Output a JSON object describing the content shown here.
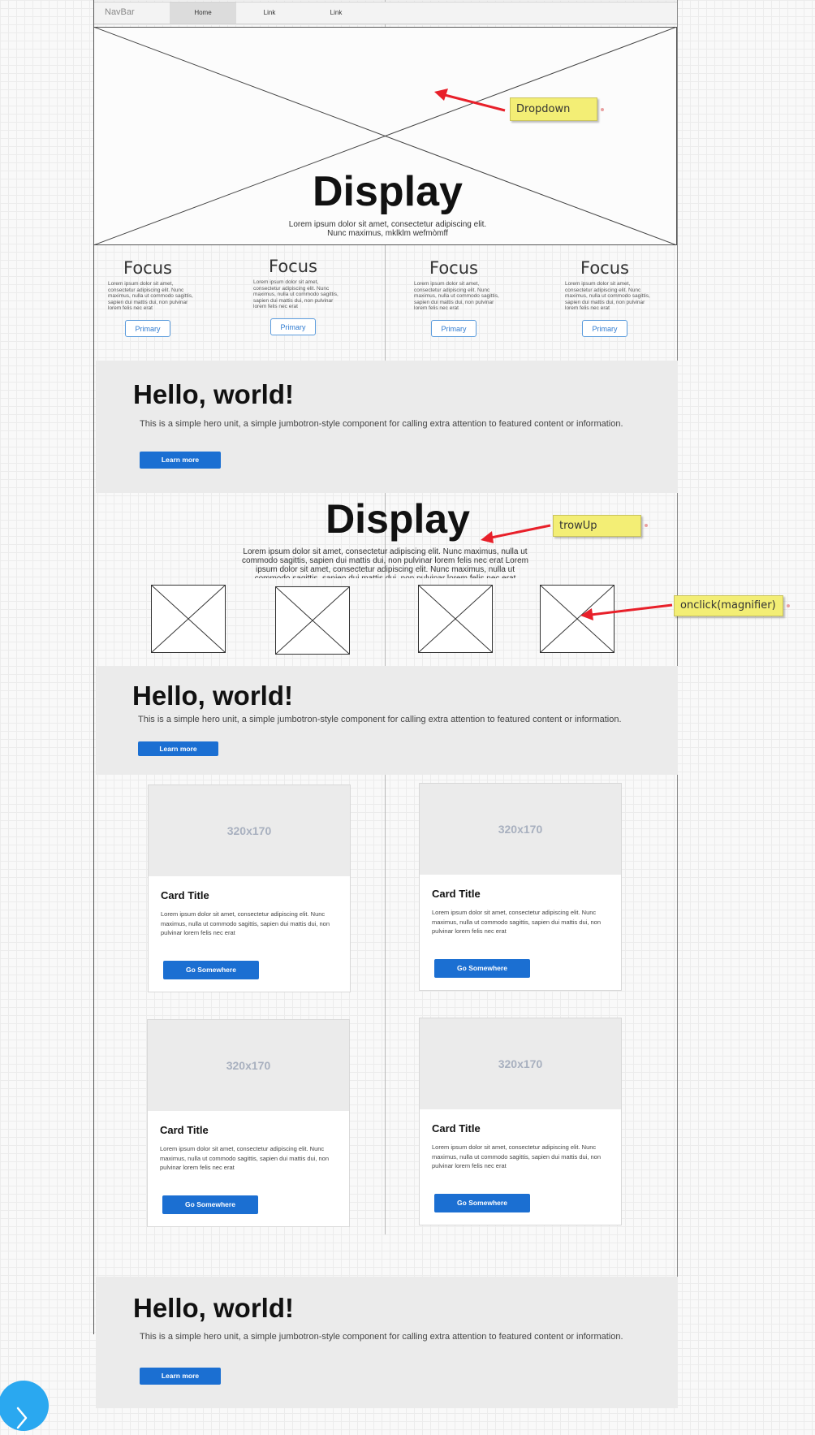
{
  "navbar": {
    "brand": "NavBar",
    "items": [
      {
        "label": "Home",
        "active": true
      },
      {
        "label": "Link",
        "active": false
      },
      {
        "label": "Link",
        "active": false
      }
    ]
  },
  "hero": {
    "display": "Display",
    "text": "Lorem ipsum dolor sit amet, consectetur adipiscing elit. Nunc maximus, mklklm wefmòmff"
  },
  "focus": {
    "items": [
      {
        "title": "Focus",
        "text": "Lorem ipsum dolor sit amet, consectetur adipiscing elit. Nunc maximus, nulla ut commodo sagittis, sapien dui mattis dui, non pulvinar lorem felis nec erat",
        "button": "Primary"
      },
      {
        "title": "Focus",
        "text": "Lorem ipsum dolor sit amet, consectetur adipiscing elit. Nunc maximus, nulla ut commodo sagittis, sapien dui mattis dui, non pulvinar lorem felis nec erat",
        "button": "Primary"
      },
      {
        "title": "Focus",
        "text": "Lorem ipsum dolor sit amet, consectetur adipiscing elit. Nunc maximus, nulla ut commodo sagittis, sapien dui mattis dui, non pulvinar lorem felis nec erat",
        "button": "Primary"
      },
      {
        "title": "Focus",
        "text": "Lorem ipsum dolor sit amet, consectetur adipiscing elit. Nunc maximus, nulla ut commodo sagittis, sapien dui mattis dui, non pulvinar lorem felis nec erat",
        "button": "Primary"
      }
    ]
  },
  "jumbotron": {
    "title": "Hello, world!",
    "text": "This is a simple hero unit, a simple jumbotron-style component for calling extra attention to featured content or information.",
    "button": "Learn more"
  },
  "display2": {
    "title": "Display",
    "text": "Lorem ipsum dolor sit amet, consectetur adipiscing elit. Nunc maximus, nulla ut commodo sagittis, sapien dui mattis dui, non pulvinar lorem felis nec erat Lorem ipsum dolor sit amet, consectetur adipiscing elit. Nunc maximus, nulla ut commodo sagittis, sapien dui mattis dui, non pulvinar lorem felis nec erat"
  },
  "cards": [
    {
      "image": "320x170",
      "title": "Card Title",
      "text": "Lorem ipsum dolor sit amet, consectetur adipiscing elit. Nunc maximus, nulla ut commodo sagittis, sapien dui mattis dui, non pulvinar lorem felis nec erat",
      "button": "Go Somewhere"
    },
    {
      "image": "320x170",
      "title": "Card Title",
      "text": "Lorem ipsum dolor sit amet, consectetur adipiscing elit. Nunc maximus, nulla ut commodo sagittis, sapien dui mattis dui, non pulvinar lorem felis nec erat",
      "button": "Go Somewhere"
    },
    {
      "image": "320x170",
      "title": "Card Title",
      "text": "Lorem ipsum dolor sit amet, consectetur adipiscing elit. Nunc maximus, nulla ut commodo sagittis, sapien dui mattis dui, non pulvinar lorem felis nec erat",
      "button": "Go Somewhere"
    },
    {
      "image": "320x170",
      "title": "Card Title",
      "text": "Lorem ipsum dolor sit amet, consectetur adipiscing elit. Nunc maximus, nulla ut commodo sagittis, sapien dui mattis dui, non pulvinar lorem felis nec erat",
      "button": "Go Somewhere"
    }
  ],
  "annotations": {
    "dropdown": "Dropdown",
    "trowup": "trowUp",
    "magnifier": "onclick(magnifier)"
  },
  "icons": {
    "next": "chevron-right-icon"
  },
  "colors": {
    "primary": "#1b6fd2",
    "note": "#f3ee75",
    "arrow": "#e8202a",
    "fab": "#2aa8f0"
  }
}
